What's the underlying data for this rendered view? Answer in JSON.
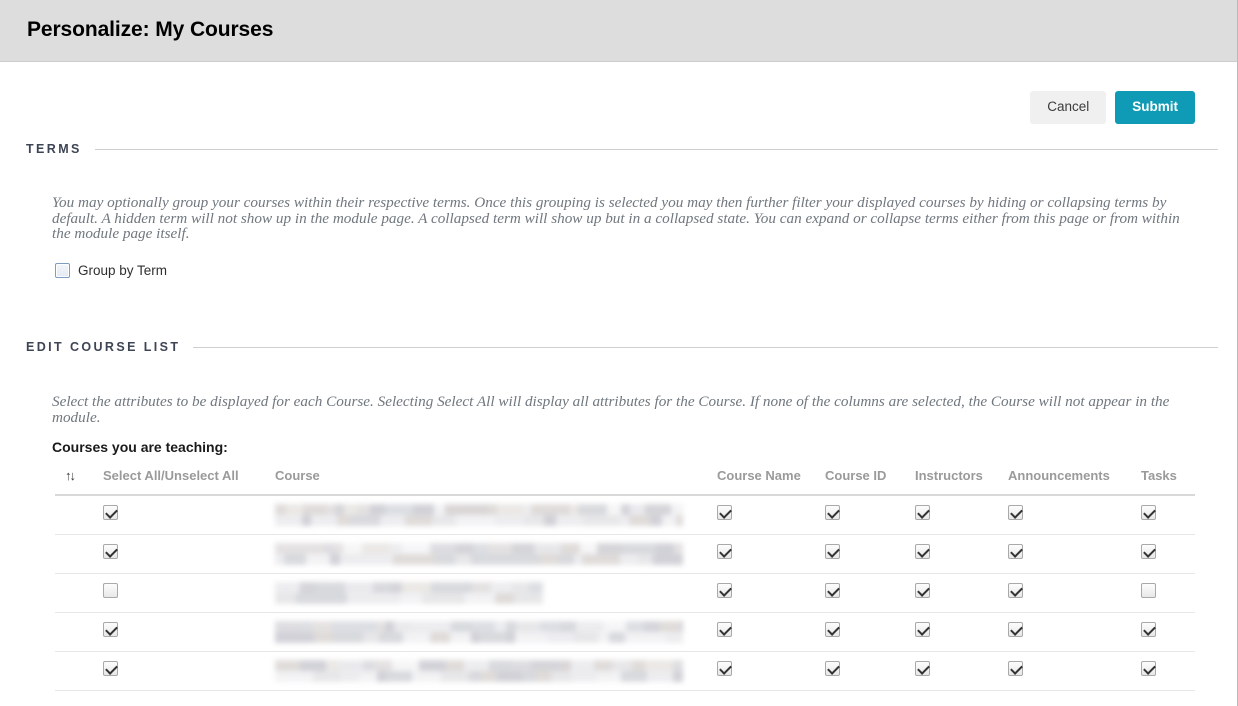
{
  "titlebar": {
    "title": "Personalize: My Courses"
  },
  "actions": {
    "cancel_label": "Cancel",
    "submit_label": "Submit"
  },
  "colors": {
    "submit_bg": "#0f9bb5",
    "cancel_bg": "#f0f0f0",
    "titlebar_bg": "#dddddd",
    "section_heading": "#3d4454",
    "description_text": "#70777e",
    "table_header_text": "#9a9a9a"
  },
  "terms_section": {
    "heading": "TERMS",
    "description": "You may optionally group your courses within their respective terms. Once this grouping is selected you may then further filter your displayed courses by hiding or collapsing terms by default. A hidden term will not show up in the module page. A collapsed term will show up but in a collapsed state. You can expand or collapse terms either from this page or from within the module page itself.",
    "group_by_term": {
      "label": "Group by Term",
      "checked": false
    }
  },
  "edit_course_list_section": {
    "heading": "EDIT COURSE LIST",
    "description": "Select the attributes to be displayed for each Course. Selecting Select All will display all attributes for the Course. If none of the columns are selected, the Course will not appear in the module.",
    "teaching_label": "Courses you are teaching:",
    "table": {
      "sort_icon": "sort-updown-icon",
      "columns": [
        "Select All/Unselect All",
        "Course",
        "Course Name",
        "Course ID",
        "Instructors",
        "Announcements",
        "Tasks"
      ],
      "rows": [
        {
          "select_all": true,
          "course": "",
          "course_redacted": true,
          "course_bar_width": 408,
          "course_name": true,
          "course_id": true,
          "instructors": true,
          "announcements": true,
          "tasks": true
        },
        {
          "select_all": true,
          "course": "",
          "course_redacted": true,
          "course_bar_width": 408,
          "course_name": true,
          "course_id": true,
          "instructors": true,
          "announcements": true,
          "tasks": true
        },
        {
          "select_all": false,
          "course": "",
          "course_redacted": true,
          "course_bar_width": 268,
          "course_name": true,
          "course_id": true,
          "instructors": true,
          "announcements": true,
          "tasks": false
        },
        {
          "select_all": true,
          "course": "",
          "course_redacted": true,
          "course_bar_width": 408,
          "course_name": true,
          "course_id": true,
          "instructors": true,
          "announcements": true,
          "tasks": true
        },
        {
          "select_all": true,
          "course": "",
          "course_redacted": true,
          "course_bar_width": 408,
          "course_name": true,
          "course_id": true,
          "instructors": true,
          "announcements": true,
          "tasks": true
        }
      ]
    }
  }
}
